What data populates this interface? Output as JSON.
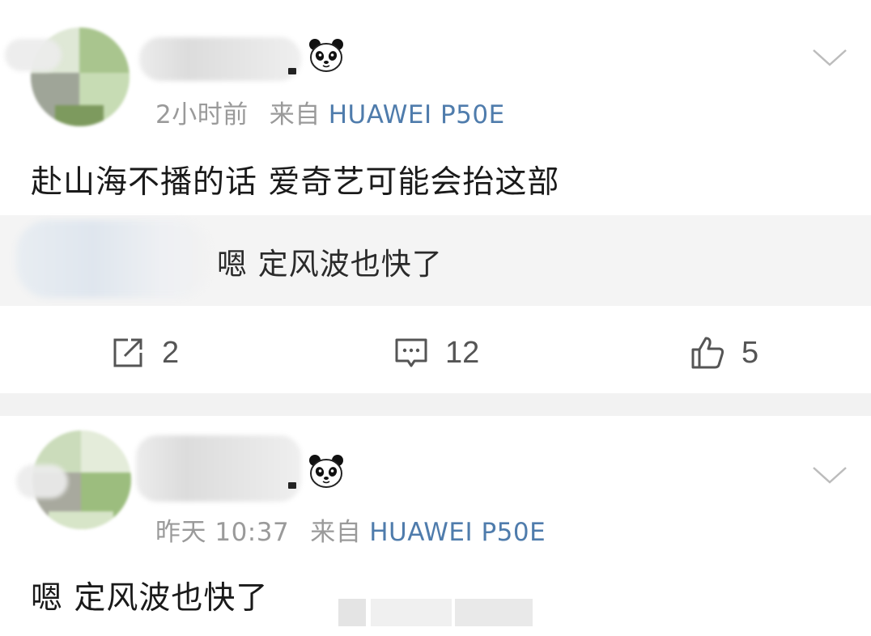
{
  "posts": [
    {
      "time": "2小时前",
      "source_prefix": "来自",
      "device": "HUAWEI P50E",
      "content": "赴山海不播的话 爱奇艺可能会抬这部",
      "quote": "嗯 定风波也快了",
      "actions": {
        "repost_count": "2",
        "comment_count": "12",
        "like_count": "5"
      }
    },
    {
      "time": "昨天 10:37",
      "source_prefix": "来自",
      "device": "HUAWEI P50E",
      "content": "嗯 定风波也快了"
    }
  ],
  "icons": {
    "badge": "panda-icon",
    "menu": "chevron-down-icon",
    "repost": "repost-icon",
    "comment": "comment-icon",
    "like": "thumbs-up-icon"
  },
  "colors": {
    "device_link": "#4f7cac",
    "meta_gray": "#9a9a9a",
    "quote_background": "#f4f4f4",
    "separator": "#f2f2f2"
  }
}
